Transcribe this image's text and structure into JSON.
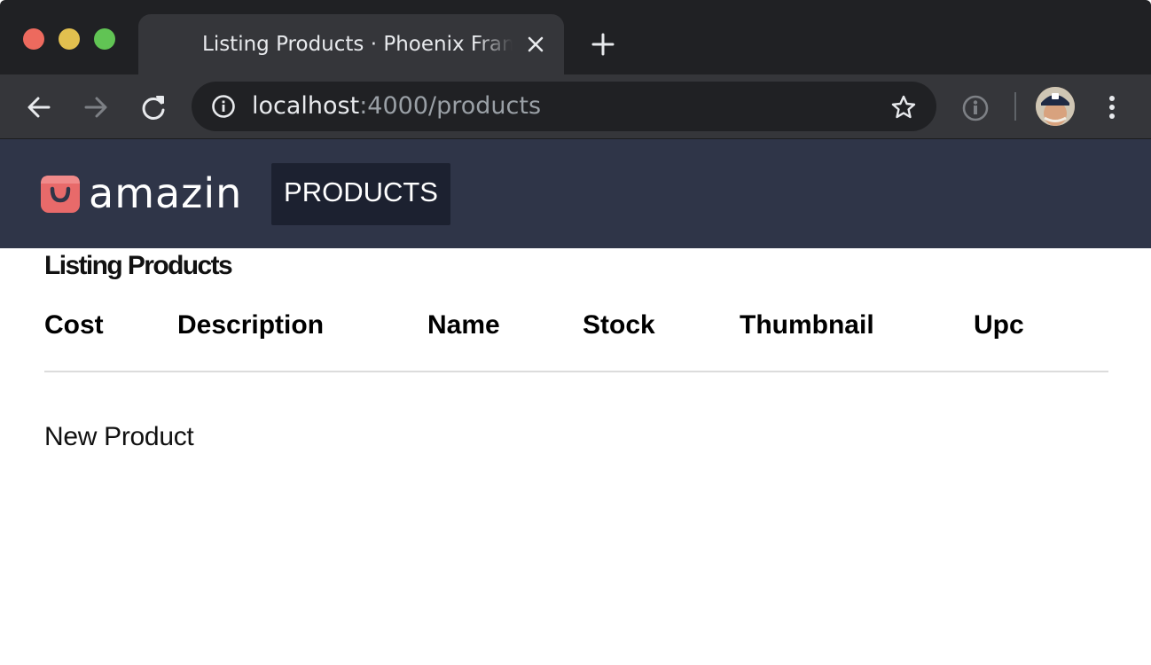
{
  "browser": {
    "tab_title": "Listing Products · Phoenix Framework",
    "url_host": "localhost",
    "url_path": ":4000/products",
    "icons": [
      "close-icon",
      "plus-icon",
      "back-arrow-icon",
      "forward-arrow-icon",
      "reload-icon",
      "info-icon",
      "star-icon",
      "extension-icon",
      "avatar",
      "more-vert-icon"
    ],
    "colors": {
      "frame": "#202124",
      "toolbar": "#35363a",
      "omnibox": "#202124"
    }
  },
  "app": {
    "brand": "amazin",
    "nav_products": "PRODUCTS",
    "colors": {
      "header_bg": "#2f3548",
      "nav_active_bg": "#1c2130",
      "logo_accent": "#e86a6a"
    }
  },
  "main": {
    "title": "Listing Products",
    "columns": [
      "Cost",
      "Description",
      "Name",
      "Stock",
      "Thumbnail",
      "Upc"
    ],
    "rows": [],
    "new_link": "New Product"
  }
}
